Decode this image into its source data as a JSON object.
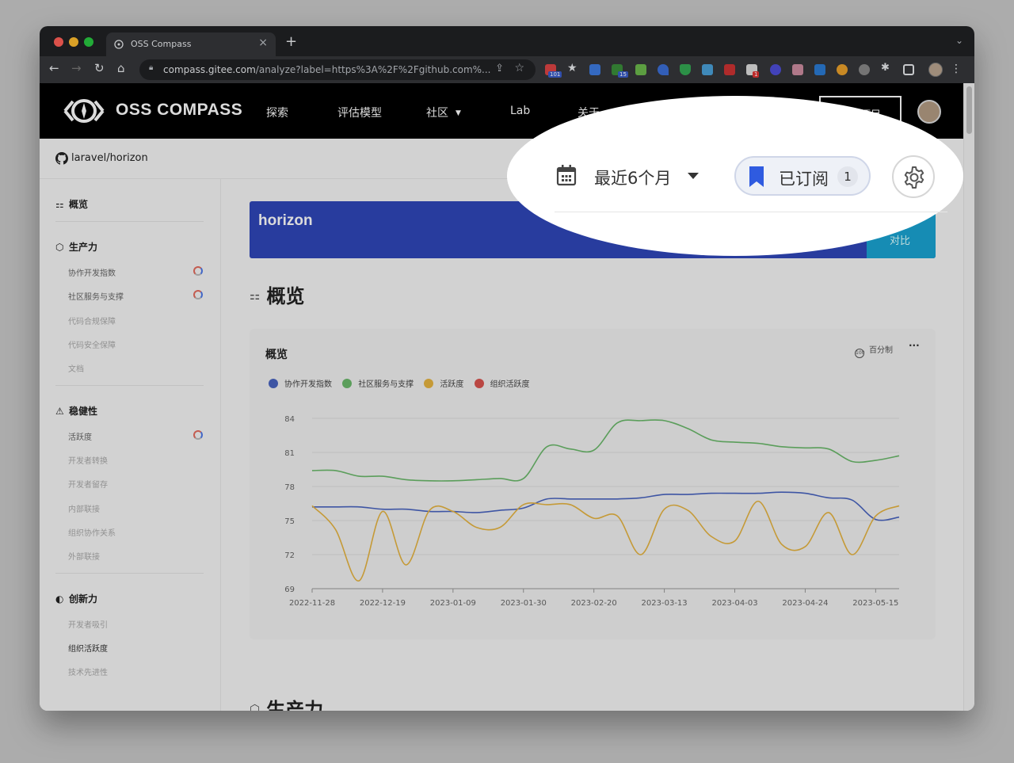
{
  "browser": {
    "tab_title": "OSS Compass",
    "new_tab": "+",
    "close": "×",
    "url_host": "compass.gitee.com",
    "url_path": "/analyze?label=https%3A%2F%2Fgithub.com%...",
    "ext_badges": [
      "101",
      "15",
      "1"
    ]
  },
  "header": {
    "logo_text": "OSS COMPASS",
    "nav": [
      "探索",
      "评估模型",
      "社区",
      "Lab",
      "关于"
    ],
    "submit_label": "提交项目"
  },
  "repo": {
    "name": "laravel/horizon"
  },
  "sidebar": {
    "sections": [
      {
        "label": "概览",
        "items": []
      },
      {
        "label": "生产力",
        "items": [
          {
            "label": "协作开发指数",
            "loading": true
          },
          {
            "label": "社区服务与支撑",
            "loading": true
          },
          {
            "label": "代码合规保障",
            "loading": false
          },
          {
            "label": "代码安全保障",
            "loading": false
          },
          {
            "label": "文档",
            "loading": false
          }
        ]
      },
      {
        "label": "稳健性",
        "items": [
          {
            "label": "活跃度",
            "loading": true
          },
          {
            "label": "开发者转换",
            "loading": false
          },
          {
            "label": "开发者留存",
            "loading": false
          },
          {
            "label": "内部联接",
            "loading": false
          },
          {
            "label": "组织协作关系",
            "loading": false
          },
          {
            "label": "外部联接",
            "loading": false
          }
        ]
      },
      {
        "label": "创新力",
        "items": [
          {
            "label": "开发者吸引",
            "loading": false
          },
          {
            "label": "组织活跃度",
            "loading": false
          },
          {
            "label": "技术先进性",
            "loading": false
          }
        ]
      }
    ]
  },
  "main": {
    "banner_title": "horizon",
    "compare_label": "对比",
    "section_title": "概览",
    "next_section_title": "生产力"
  },
  "card": {
    "title": "概览",
    "percent_label": "百分制",
    "more": "···"
  },
  "filters": {
    "date_range": "最近6个月",
    "subscribed_label": "已订阅",
    "subscribed_count": "1"
  },
  "colors": {
    "blue": "#4964bf",
    "green": "#6ab86a",
    "yellow": "#e6b441",
    "red": "#d9534f",
    "banner": "#2f46b8",
    "compare": "#1aa3d2"
  },
  "chart_data": {
    "type": "line",
    "title": "概览",
    "xlabel": "",
    "ylabel": "",
    "ylim": [
      69,
      84
    ],
    "yticks": [
      69,
      72,
      75,
      78,
      81,
      84
    ],
    "xticks": [
      "2022-11-28",
      "2022-12-19",
      "2023-01-09",
      "2023-01-30",
      "2023-02-20",
      "2023-03-13",
      "2023-04-03",
      "2023-04-24",
      "2023-05-15"
    ],
    "x": [
      "2022-11-28",
      "2022-12-05",
      "2022-12-12",
      "2022-12-19",
      "2022-12-26",
      "2023-01-02",
      "2023-01-09",
      "2023-01-16",
      "2023-01-23",
      "2023-01-30",
      "2023-02-06",
      "2023-02-13",
      "2023-02-20",
      "2023-02-27",
      "2023-03-06",
      "2023-03-13",
      "2023-03-20",
      "2023-03-27",
      "2023-04-03",
      "2023-04-10",
      "2023-04-17",
      "2023-04-24",
      "2023-05-01",
      "2023-05-08",
      "2023-05-15",
      "2023-05-22"
    ],
    "series": [
      {
        "name": "协作开发指数",
        "color": "#4964bf",
        "values": [
          76.2,
          76.2,
          76.2,
          76.0,
          76.0,
          75.8,
          75.8,
          75.7,
          75.9,
          76.1,
          76.9,
          76.9,
          76.9,
          76.9,
          77.0,
          77.3,
          77.3,
          77.4,
          77.4,
          77.4,
          77.5,
          77.4,
          77.0,
          76.8,
          75.1,
          75.3
        ]
      },
      {
        "name": "社区服务与支撑",
        "color": "#6ab86a",
        "values": [
          79.4,
          79.4,
          78.9,
          78.9,
          78.6,
          78.5,
          78.5,
          78.6,
          78.7,
          78.7,
          81.5,
          81.3,
          81.2,
          83.6,
          83.8,
          83.8,
          83.1,
          82.1,
          81.9,
          81.8,
          81.5,
          81.4,
          81.3,
          80.2,
          80.3,
          80.7
        ]
      },
      {
        "name": "活跃度",
        "color": "#e6b441",
        "values": [
          76.3,
          74.2,
          69.7,
          75.8,
          71.1,
          75.9,
          75.8,
          74.4,
          74.4,
          76.4,
          76.4,
          76.4,
          75.2,
          75.4,
          72.0,
          76.0,
          75.9,
          73.6,
          73.2,
          76.7,
          72.9,
          72.7,
          75.7,
          72.0,
          75.4,
          76.3
        ]
      },
      {
        "name": "组织活跃度",
        "color": "#d9534f",
        "values": []
      }
    ],
    "grid": true,
    "legend_position": "top-left"
  }
}
